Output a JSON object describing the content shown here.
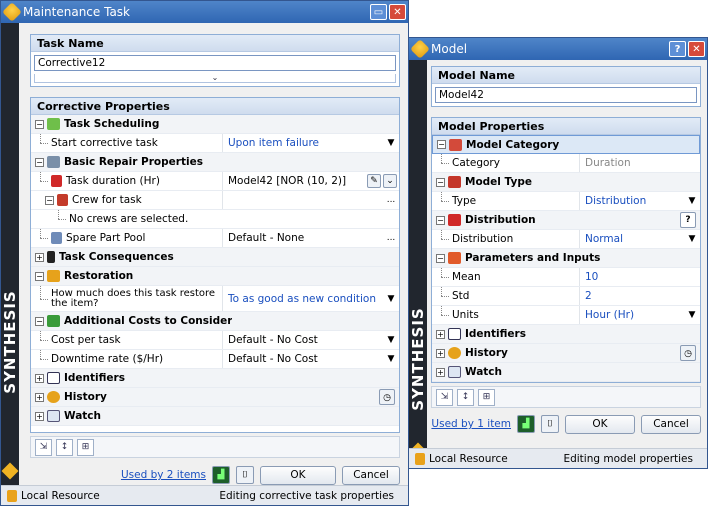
{
  "w1": {
    "title": "Maintenance Task",
    "task_name_label": "Task Name",
    "task_name_value": "Corrective12",
    "props_header": "Corrective Properties",
    "rows": {
      "scheduling": "Task Scheduling",
      "start_label": "Start corrective task",
      "start_value": "Upon item failure",
      "basic_repair": "Basic Repair Properties",
      "duration_label": "Task duration (Hr)",
      "duration_value": "Model42 [NOR (10, 2)]",
      "crew_label": "Crew for task",
      "crew_value": "...",
      "no_crews": "No crews are selected.",
      "spare_label": "Spare Part Pool",
      "spare_value": "Default - None",
      "spare_more": "...",
      "consequences": "Task Consequences",
      "restoration": "Restoration",
      "restore_q": "How much does this task restore the item?",
      "restore_value": "To as good as new condition",
      "costs": "Additional Costs to Consider",
      "cost_label": "Cost per task",
      "cost_value": "Default - No Cost",
      "downtime_label": "Downtime rate ($/Hr)",
      "downtime_value": "Default - No Cost",
      "identifiers": "Identifiers",
      "history": "History",
      "watch": "Watch"
    },
    "used_by": "Used by 2 items",
    "ok": "OK",
    "cancel": "Cancel",
    "status_left": "Local Resource",
    "status_right": "Editing corrective task properties",
    "side_text": "SYNTHESIS"
  },
  "w2": {
    "title": "Model",
    "model_name_label": "Model Name",
    "model_name_value": "Model42",
    "props_header": "Model Properties",
    "rows": {
      "category_hdr": "Model Category",
      "category_label": "Category",
      "category_value": "Duration",
      "type_hdr": "Model Type",
      "type_label": "Type",
      "type_value": "Distribution",
      "dist_hdr": "Distribution",
      "dist_label": "Distribution",
      "dist_value": "Normal",
      "params_hdr": "Parameters and Inputs",
      "mean_label": "Mean",
      "mean_value": "10",
      "std_label": "Std",
      "std_value": "2",
      "units_label": "Units",
      "units_value": "Hour (Hr)",
      "identifiers": "Identifiers",
      "history": "History",
      "watch": "Watch"
    },
    "used_by": "Used by 1 item",
    "ok": "OK",
    "cancel": "Cancel",
    "status_left": "Local Resource",
    "status_right": "Editing model properties",
    "side_text": "SYNTHESIS"
  },
  "colors": {
    "accent": "#1a4fbf",
    "titlebar": "#3a6fb9",
    "sidebar": "#21262e"
  }
}
